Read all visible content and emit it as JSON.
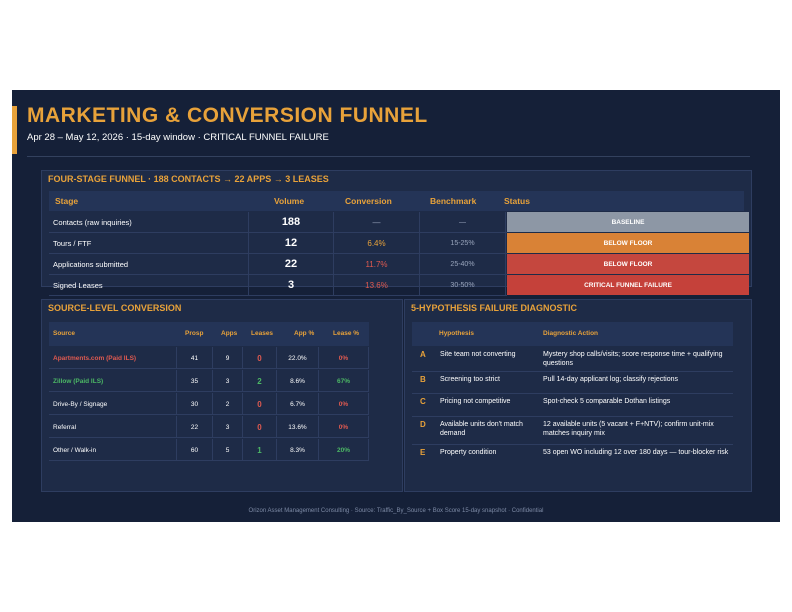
{
  "header": {
    "title": "MARKETING & CONVERSION FUNNEL",
    "subtitle": "Apr 28 – May 12, 2026  ·  15-day window  ·  CRITICAL FUNNEL FAILURE"
  },
  "funnel": {
    "heading": "FOUR-STAGE FUNNEL  ·  188 CONTACTS → 22 APPS → 3 LEASES",
    "columns": [
      "Stage",
      "Volume",
      "Conversion",
      "Benchmark",
      "Status"
    ],
    "rows": [
      {
        "stage": "Contacts (raw inquiries)",
        "volume": "188",
        "conversion": "—",
        "benchmark": "—",
        "status": "BASELINE",
        "status_color": "#8d97a5",
        "conv_color": "#9aa6bd"
      },
      {
        "stage": "Tours / FTF",
        "volume": "12",
        "conversion": "6.4%",
        "benchmark": "15-25%",
        "status": "BELOW FLOOR",
        "status_color": "#d98236",
        "conv_color": "#e8a23a"
      },
      {
        "stage": "Applications submitted",
        "volume": "22",
        "conversion": "11.7%",
        "benchmark": "25-40%",
        "status": "BELOW FLOOR",
        "status_color": "#c5473e",
        "conv_color": "#e05a50"
      },
      {
        "stage": "Signed Leases",
        "volume": "3",
        "conversion": "13.6%",
        "benchmark": "30-50%",
        "status": "CRITICAL FUNNEL FAILURE",
        "status_color": "#c5413a",
        "conv_color": "#e05a50"
      }
    ]
  },
  "source": {
    "heading": "SOURCE-LEVEL CONVERSION",
    "columns": [
      "Source",
      "Prosp",
      "Apps",
      "Leases",
      "App %",
      "Lease %"
    ],
    "rows": [
      {
        "source": "Apartments.com (Paid ILS)",
        "prosp": "41",
        "apps": "9",
        "leases": "0",
        "app_pct": "22.0%",
        "lease_pct": "0%",
        "source_color": "#e05a50",
        "leases_color": "#e05a50",
        "lease_pct_color": "#e05a50"
      },
      {
        "source": "Zillow (Paid ILS)",
        "prosp": "35",
        "apps": "3",
        "leases": "2",
        "app_pct": "8.6%",
        "lease_pct": "67%",
        "source_color": "#4cb865",
        "leases_color": "#4cb865",
        "lease_pct_color": "#4cb865"
      },
      {
        "source": "Drive-By / Signage",
        "prosp": "30",
        "apps": "2",
        "leases": "0",
        "app_pct": "6.7%",
        "lease_pct": "0%",
        "source_color": "#ffffff",
        "leases_color": "#e05a50",
        "lease_pct_color": "#e05a50"
      },
      {
        "source": "Referral",
        "prosp": "22",
        "apps": "3",
        "leases": "0",
        "app_pct": "13.6%",
        "lease_pct": "0%",
        "source_color": "#ffffff",
        "leases_color": "#e05a50",
        "lease_pct_color": "#e05a50"
      },
      {
        "source": "Other / Walk-in",
        "prosp": "60",
        "apps": "5",
        "leases": "1",
        "app_pct": "8.3%",
        "lease_pct": "20%",
        "source_color": "#ffffff",
        "leases_color": "#4cb865",
        "lease_pct_color": "#4cb865"
      }
    ]
  },
  "diagnostic": {
    "heading": "5-HYPOTHESIS FAILURE DIAGNOSTIC",
    "columns": [
      "Hypothesis",
      "Diagnostic Action"
    ],
    "rows": [
      {
        "letter": "A",
        "hypothesis": "Site team not converting",
        "action": "Mystery shop calls/visits; score response time + qualifying questions"
      },
      {
        "letter": "B",
        "hypothesis": "Screening too strict",
        "action": "Pull 14-day applicant log; classify rejections"
      },
      {
        "letter": "C",
        "hypothesis": "Pricing not competitive",
        "action": "Spot-check 5 comparable Dothan listings"
      },
      {
        "letter": "D",
        "hypothesis": "Available units don't match demand",
        "action": "12 available units (5 vacant + F+NTV); confirm unit-mix matches inquiry mix"
      },
      {
        "letter": "E",
        "hypothesis": "Property condition",
        "action": "53 open WO including 12 over 180 days — tour-blocker risk"
      }
    ]
  },
  "footer": {
    "text": "Orizon Asset Management Consulting  ·  Source: Traffic_By_Source + Box Score 15-day snapshot  ·  Confidential"
  }
}
